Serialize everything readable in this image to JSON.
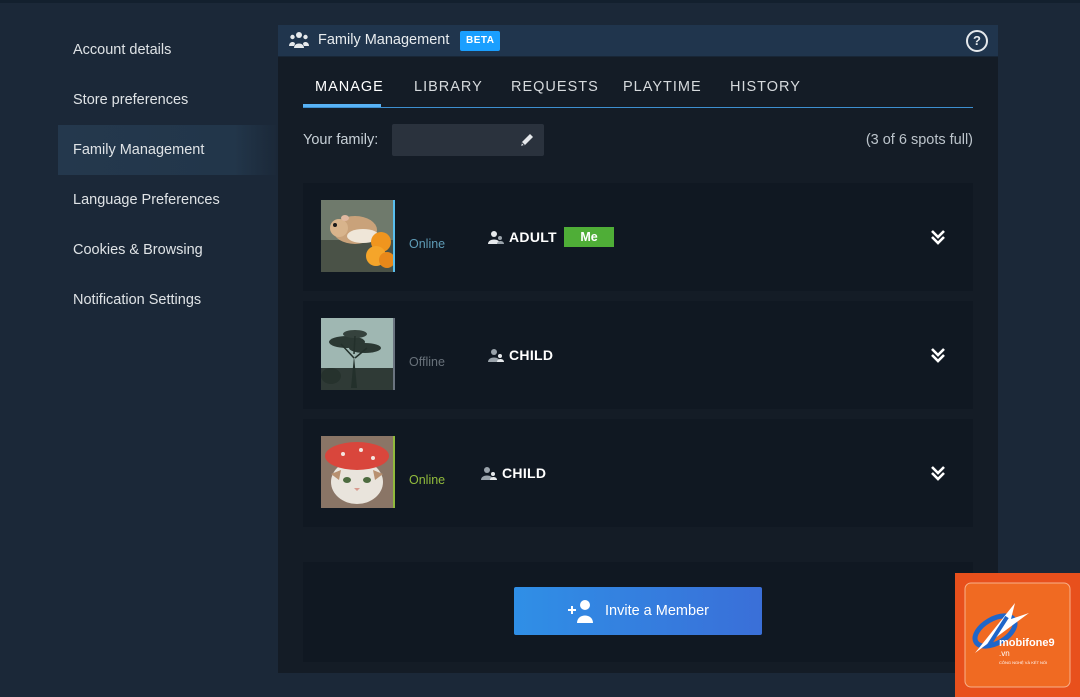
{
  "sidebar": {
    "items": [
      {
        "label": "Account details"
      },
      {
        "label": "Store preferences"
      },
      {
        "label": "Family Management",
        "active": true
      },
      {
        "label": "Language Preferences"
      },
      {
        "label": "Cookies & Browsing"
      },
      {
        "label": "Notification Settings"
      }
    ]
  },
  "header": {
    "title": "Family Management",
    "badge": "BETA",
    "help_glyph": "?"
  },
  "tabs": [
    {
      "label": "MANAGE",
      "active": true
    },
    {
      "label": "LIBRARY"
    },
    {
      "label": "REQUESTS"
    },
    {
      "label": "PLAYTIME"
    },
    {
      "label": "HISTORY"
    }
  ],
  "family": {
    "label": "Your family:",
    "name_value": "",
    "spots": "(3 of 6 spots full)"
  },
  "members": [
    {
      "status": "Online",
      "status_type": "online",
      "role": "ADULT",
      "badge": "Me",
      "avatar": "hamster-photo"
    },
    {
      "status": "Offline",
      "status_type": "offline",
      "role": "CHILD",
      "avatar": "tree-photo"
    },
    {
      "status": "Online",
      "status_type": "ingame",
      "role": "CHILD",
      "avatar": "cat-photo"
    }
  ],
  "invite": {
    "label": "Invite a Member"
  },
  "watermark": {
    "brand": "mobifone9",
    "domain": ".vn",
    "tagline": "CÔNG NGHỆ VÀ KẾT NỐI"
  },
  "colors": {
    "background": "#1b2838",
    "accent": "#1a9fff",
    "me_badge": "#4fae37",
    "invite_button": "#2f8fe6"
  }
}
